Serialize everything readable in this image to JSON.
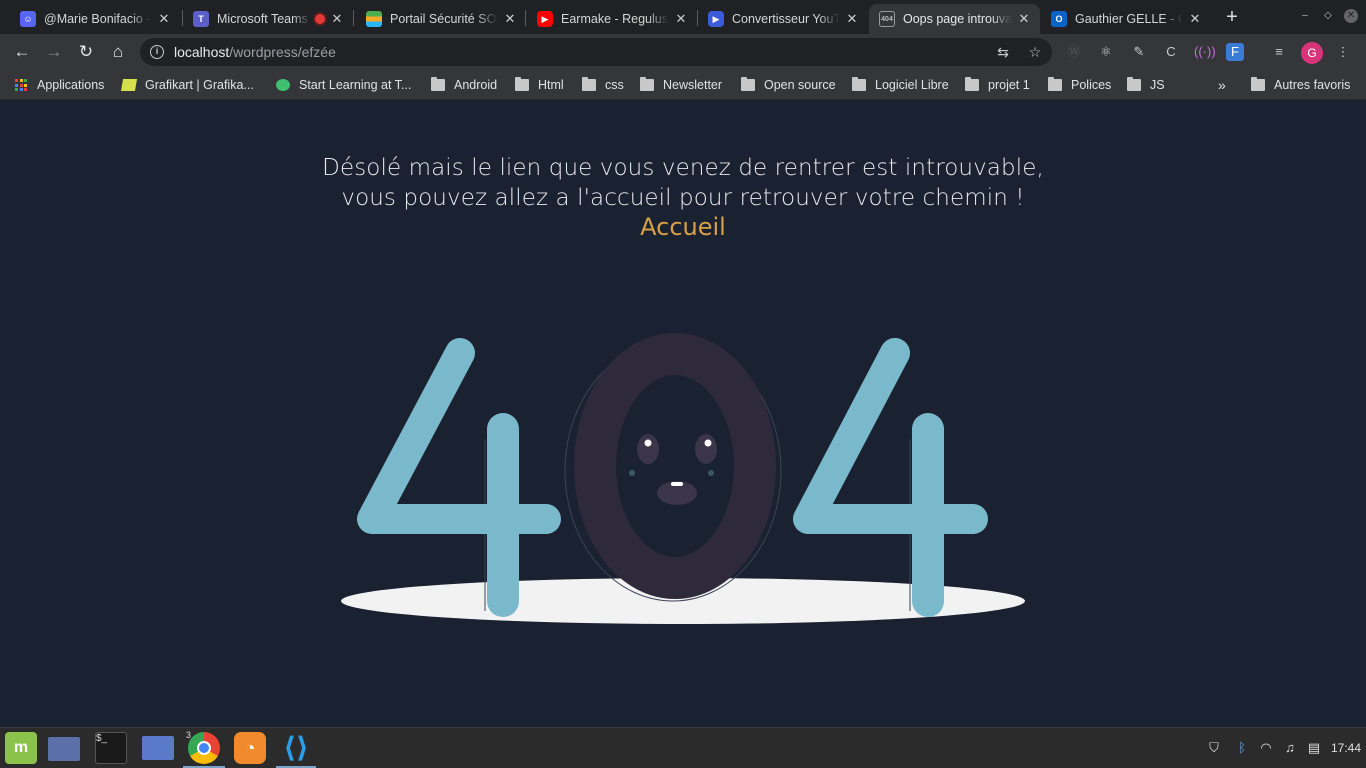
{
  "tabs": [
    {
      "title": "@Marie Bonifacio - ",
      "favicon": "discord-icon",
      "color": "#5865f2"
    },
    {
      "title": "Microsoft Teams",
      "favicon": "teams-icon",
      "color": "#5b5fc7",
      "recording": true
    },
    {
      "title": "Portail Sécurité SOC",
      "favicon": "portal-icon",
      "color": "#4caf50"
    },
    {
      "title": "Earmake - Regulus",
      "favicon": "youtube-icon",
      "color": "#ff0000"
    },
    {
      "title": "Convertisseur YouTube",
      "favicon": "converter-icon",
      "color": "#3b5bdb"
    },
    {
      "title": "Oops page introuvable",
      "favicon": "page-icon",
      "color": "#8a8a8a",
      "active": true
    },
    {
      "title": "Gauthier GELLE - Outlook",
      "favicon": "outlook-icon",
      "color": "#0a64c8"
    }
  ],
  "url": {
    "host": "localhost",
    "path": "/wordpress/efzée"
  },
  "bookmarks": [
    {
      "label": "Applications",
      "type": "apps"
    },
    {
      "label": "Grafikart | Grafika...",
      "type": "site"
    },
    {
      "label": "Start Learning at T...",
      "type": "site"
    },
    {
      "label": "Android",
      "type": "folder"
    },
    {
      "label": "Html",
      "type": "folder"
    },
    {
      "label": "css",
      "type": "folder"
    },
    {
      "label": "Newsletter",
      "type": "folder"
    },
    {
      "label": "Open source",
      "type": "folder"
    },
    {
      "label": "Logiciel Libre",
      "type": "folder"
    },
    {
      "label": "projet 1",
      "type": "folder"
    },
    {
      "label": "Polices",
      "type": "folder"
    },
    {
      "label": "JS",
      "type": "folder"
    }
  ],
  "other_bookmarks": "Autres favoris",
  "page": {
    "message_line1": "Désolé mais le lien que vous venez de rentrer est introuvable,",
    "message_line2": "vous pouvez allez a l'accueil pour retrouver votre chemin !",
    "home_link": "Accueil",
    "illustration_text": "404"
  },
  "profile_initial": "G",
  "taskbar": {
    "chrome_badge": "3",
    "clock": "17:44"
  },
  "colors": {
    "page_bg": "#1a2130",
    "accent": "#d8a047",
    "digit_four": "#7ab8cc",
    "digit_zero": "#2e2a3c",
    "shadow": "#f2f2f2"
  }
}
